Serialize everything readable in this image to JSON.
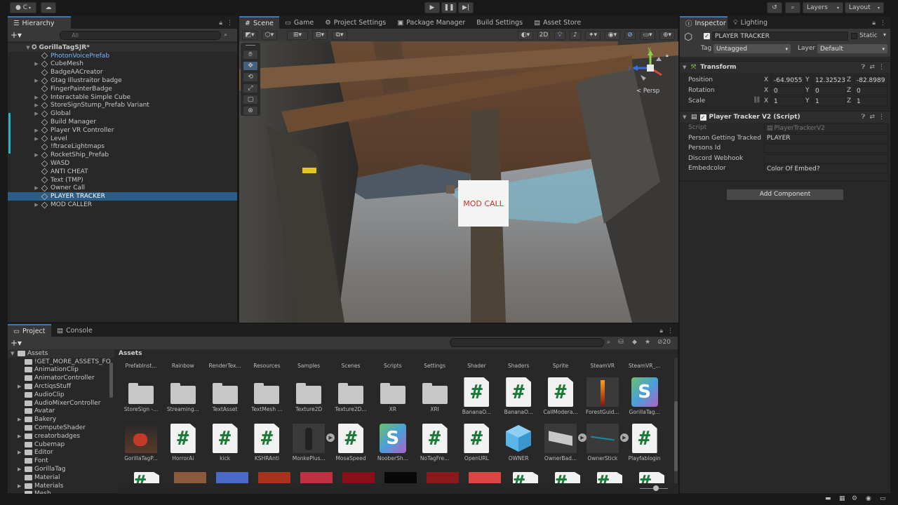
{
  "toolbar": {
    "account_label": "C",
    "layers_label": "Layers",
    "layout_label": "Layout"
  },
  "hierarchy": {
    "tab": "Hierarchy",
    "search_placeholder": "All",
    "scene": "GorillaTagSJR*",
    "items": [
      {
        "label": "PhotonVoicePrefab",
        "arrow": "",
        "style": "blue"
      },
      {
        "label": "CubeMesh",
        "arrow": "▶",
        "style": ""
      },
      {
        "label": "BadgeAACreator",
        "arrow": "",
        "style": ""
      },
      {
        "label": "Gtag Illustraitor badge",
        "arrow": "▶",
        "style": ""
      },
      {
        "label": "FingerPainterBadge",
        "arrow": "",
        "style": ""
      },
      {
        "label": "Interactable Simple Cube",
        "arrow": "▶",
        "style": ""
      },
      {
        "label": "StoreSignStump_Prefab Variant",
        "arrow": "▶",
        "style": ""
      },
      {
        "label": "Global",
        "arrow": "▶",
        "style": ""
      },
      {
        "label": "Build Manager",
        "arrow": "",
        "style": ""
      },
      {
        "label": "Player VR Controller",
        "arrow": "▶",
        "style": ""
      },
      {
        "label": "Level",
        "arrow": "▶",
        "style": ""
      },
      {
        "label": "!ftraceLightmaps",
        "arrow": "",
        "style": ""
      },
      {
        "label": "RocketShip_Prefab",
        "arrow": "▶",
        "style": ""
      },
      {
        "label": "WASD",
        "arrow": "",
        "style": ""
      },
      {
        "label": "ANTI CHEAT",
        "arrow": "",
        "style": ""
      },
      {
        "label": "Text (TMP)",
        "arrow": "",
        "style": ""
      },
      {
        "label": "Owner Call",
        "arrow": "▶",
        "style": ""
      },
      {
        "label": "PLAYER TRACKER",
        "arrow": "",
        "style": "sel"
      },
      {
        "label": "MOD CALLER",
        "arrow": "▶",
        "style": ""
      }
    ]
  },
  "center_tabs": [
    "Scene",
    "Game",
    "Project Settings",
    "Package Manager",
    "Build Settings",
    "Asset Store"
  ],
  "scene_view": {
    "mode_2d": "2D",
    "persp_label": "< Persp",
    "sign_text": "MOD CALL",
    "axis_y": "y",
    "axis_z": "z"
  },
  "inspector": {
    "tabs": [
      "Inspector",
      "Lighting"
    ],
    "object_name": "PLAYER TRACKER",
    "static_label": "Static",
    "tag_label": "Tag",
    "tag_value": "Untagged",
    "layer_label": "Layer",
    "layer_value": "Default",
    "transform": {
      "title": "Transform",
      "position_label": "Position",
      "rotation_label": "Rotation",
      "scale_label": "Scale",
      "position": [
        "-64.9055",
        "12.32523",
        "-82.8989"
      ],
      "rotation": [
        "0",
        "0",
        "0"
      ],
      "scale": [
        "1",
        "1",
        "1"
      ],
      "axes": [
        "X",
        "Y",
        "Z"
      ]
    },
    "component": {
      "title": "Player Tracker V2 (Script)",
      "script_label": "Script",
      "script_value": "PlayerTrackerV2",
      "fields": [
        {
          "label": "Person Getting Tracked",
          "value": "PLAYER"
        },
        {
          "label": "Persons Id",
          "value": ""
        },
        {
          "label": "Discord Webhook",
          "value": ""
        },
        {
          "label": "Embedcolor",
          "value": "Color Of Embed?"
        }
      ]
    },
    "add_component": "Add Component"
  },
  "project": {
    "tabs": [
      "Project",
      "Console"
    ],
    "hidden_count": "20",
    "assets_root": "Assets",
    "breadcrumb": "Assets",
    "folders": [
      "!GET_MORE_ASSETS_FO",
      "AnimationClip",
      "AnimatorController",
      "ArctiqsStuff",
      "AudioClip",
      "AudioMixerController",
      "Avatar",
      "Bakery",
      "ComputeShader",
      "creatorbadges",
      "Cubemap",
      "Editor",
      "Font",
      "GorillaTag",
      "Material",
      "Materials",
      "Mesh"
    ],
    "folder_arrows": [
      "",
      "",
      "",
      "▶",
      "",
      "",
      "",
      "▶",
      "",
      "▶",
      "",
      "▶",
      "",
      "▶",
      "",
      "▶",
      ""
    ],
    "top_labels": [
      "PrefabInst...",
      "Rainbow",
      "RenderTex...",
      "Resources",
      "Samples",
      "Scenes",
      "Scripts",
      "Settings",
      "Shader",
      "Shaders",
      "Sprite",
      "SteamVR",
      "SteamVR_..."
    ],
    "row1": [
      {
        "label": "StoreSign -...",
        "kind": "folder"
      },
      {
        "label": "Streaming...",
        "kind": "folder"
      },
      {
        "label": "TextAsset",
        "kind": "folder"
      },
      {
        "label": "TextMesh ...",
        "kind": "folder"
      },
      {
        "label": "Texture2D",
        "kind": "folder"
      },
      {
        "label": "Texture2D...",
        "kind": "folder"
      },
      {
        "label": "XR",
        "kind": "folder"
      },
      {
        "label": "XRI",
        "kind": "folder"
      },
      {
        "label": "BananaO...",
        "kind": "script"
      },
      {
        "label": "BananaO...",
        "kind": "script"
      },
      {
        "label": "CallModera...",
        "kind": "script"
      },
      {
        "label": "ForestGuid...",
        "kind": "torch"
      },
      {
        "label": "GorillaTag...",
        "kind": "shader"
      }
    ],
    "row2": [
      {
        "label": "GorillaTagP...",
        "kind": "scene"
      },
      {
        "label": "HorrorAi",
        "kind": "script"
      },
      {
        "label": "kick",
        "kind": "script"
      },
      {
        "label": "KSHRAnti",
        "kind": "script"
      },
      {
        "label": "MonkePlus...",
        "kind": "model"
      },
      {
        "label": "MosaSpeed",
        "kind": "script"
      },
      {
        "label": "NooberSh...",
        "kind": "shader"
      },
      {
        "label": "NoTagFre...",
        "kind": "script"
      },
      {
        "label": "OpenURL",
        "kind": "script"
      },
      {
        "label": "OWNER",
        "kind": "cube"
      },
      {
        "label": "OwnerBad...",
        "kind": "slab"
      },
      {
        "label": "OwnerStick",
        "kind": "stick"
      },
      {
        "label": "Playfablogin",
        "kind": "script"
      }
    ]
  },
  "colors": {
    "selection": "#2c5d87",
    "accent_blue": "#3a79bb",
    "script_green": "#1b7a37",
    "sign_text": "#c8352c"
  }
}
